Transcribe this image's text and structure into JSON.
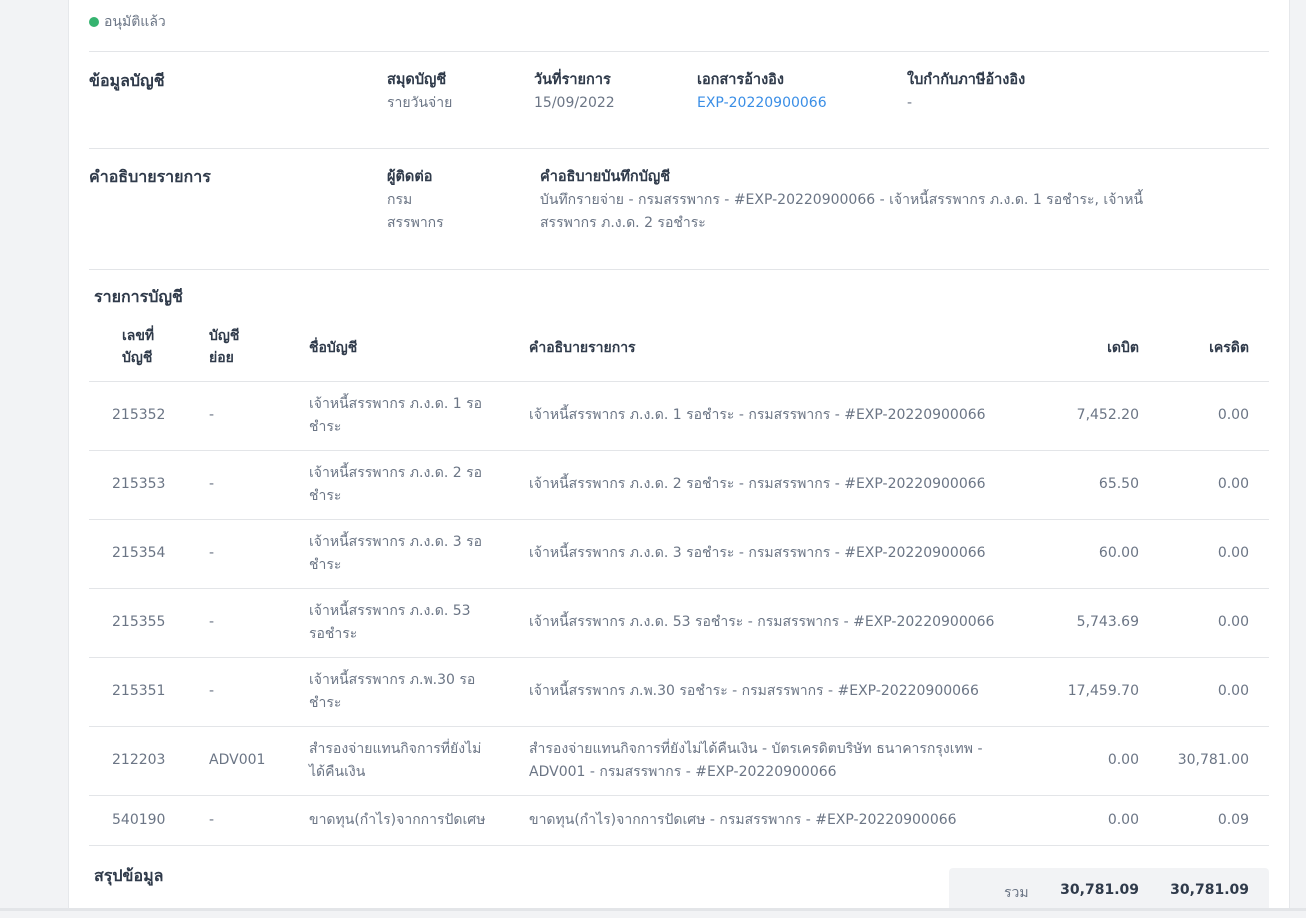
{
  "status": {
    "label": "อนุมัติแล้ว",
    "color": "#35b36f"
  },
  "account_info": {
    "title": "ข้อมูลบัญชี",
    "journal_label": "สมุดบัญชี",
    "journal_value": "รายวันจ่าย",
    "date_label": "วันที่รายการ",
    "date_value": "15/09/2022",
    "ref_doc_label": "เอกสารอ้างอิง",
    "ref_doc_value": "EXP-20220900066",
    "tax_invoice_label": "ใบกำกับภาษีอ้างอิง",
    "tax_invoice_value": "-"
  },
  "description": {
    "title": "คำอธิบายรายการ",
    "contact_label": "ผู้ติดต่อ",
    "contact_line1": "กรม",
    "contact_line2": "สรรพากร",
    "memo_label": "คำอธิบายบันทึกบัญชี",
    "memo_line1": "บันทึกรายจ่าย - กรมสรรพากร - #EXP-20220900066 - เจ้าหนี้สรรพากร ภ.ง.ด. 1 รอชำระ, เจ้าหนี้",
    "memo_line2": "สรรพากร ภ.ง.ด. 2 รอชำระ"
  },
  "ledger": {
    "title": "รายการบัญชี",
    "headers": {
      "acct_no_1": "เลขที่",
      "acct_no_2": "บัญชี",
      "sub_1": "บัญชี",
      "sub_2": "ย่อย",
      "name": "ชื่อบัญชี",
      "desc": "คำอธิบายรายการ",
      "debit": "เดบิต",
      "credit": "เครดิต"
    },
    "rows": [
      {
        "no": "215352",
        "sub": "-",
        "name1": "เจ้าหนี้สรรพากร ภ.ง.ด. 1 รอ",
        "name2": "ชำระ",
        "desc1": "เจ้าหนี้สรรพากร ภ.ง.ด. 1 รอชำระ - กรมสรรพากร - #EXP-20220900066",
        "desc2": "",
        "debit": "7,452.20",
        "credit": "0.00"
      },
      {
        "no": "215353",
        "sub": "-",
        "name1": "เจ้าหนี้สรรพากร ภ.ง.ด. 2 รอ",
        "name2": "ชำระ",
        "desc1": "เจ้าหนี้สรรพากร ภ.ง.ด. 2 รอชำระ - กรมสรรพากร - #EXP-20220900066",
        "desc2": "",
        "debit": "65.50",
        "credit": "0.00"
      },
      {
        "no": "215354",
        "sub": "-",
        "name1": "เจ้าหนี้สรรพากร ภ.ง.ด. 3 รอ",
        "name2": "ชำระ",
        "desc1": "เจ้าหนี้สรรพากร ภ.ง.ด. 3 รอชำระ - กรมสรรพากร - #EXP-20220900066",
        "desc2": "",
        "debit": "60.00",
        "credit": "0.00"
      },
      {
        "no": "215355",
        "sub": "-",
        "name1": "เจ้าหนี้สรรพากร ภ.ง.ด. 53",
        "name2": "รอชำระ",
        "desc1": "เจ้าหนี้สรรพากร ภ.ง.ด. 53 รอชำระ - กรมสรรพากร - #EXP-20220900066",
        "desc2": "",
        "debit": "5,743.69",
        "credit": "0.00"
      },
      {
        "no": "215351",
        "sub": "-",
        "name1": "เจ้าหนี้สรรพากร ภ.พ.30 รอ",
        "name2": "ชำระ",
        "desc1": "เจ้าหนี้สรรพากร ภ.พ.30 รอชำระ - กรมสรรพากร - #EXP-20220900066",
        "desc2": "",
        "debit": "17,459.70",
        "credit": "0.00"
      },
      {
        "no": "212203",
        "sub": "ADV001",
        "name1": "สำรองจ่ายแทนกิจการที่ยังไม่",
        "name2": "ได้คืนเงิน",
        "desc1": "สำรองจ่ายแทนกิจการที่ยังไม่ได้คืนเงิน - บัตรเครดิตบริษัท ธนาคารกรุงเทพ -",
        "desc2": "ADV001 - กรมสรรพากร - #EXP-20220900066",
        "debit": "0.00",
        "credit": "30,781.00"
      },
      {
        "no": "540190",
        "sub": "-",
        "name1": "ขาดทุน(กำไร)จากการปัดเศษ",
        "name2": "",
        "desc1": "ขาดทุน(กำไร)จากการปัดเศษ - กรมสรรพากร - #EXP-20220900066",
        "desc2": "",
        "debit": "0.00",
        "credit": "0.09"
      }
    ]
  },
  "summary": {
    "title": "สรุปข้อมูล",
    "total_label": "รวม",
    "total_debit": "30,781.09",
    "total_credit": "30,781.09"
  }
}
